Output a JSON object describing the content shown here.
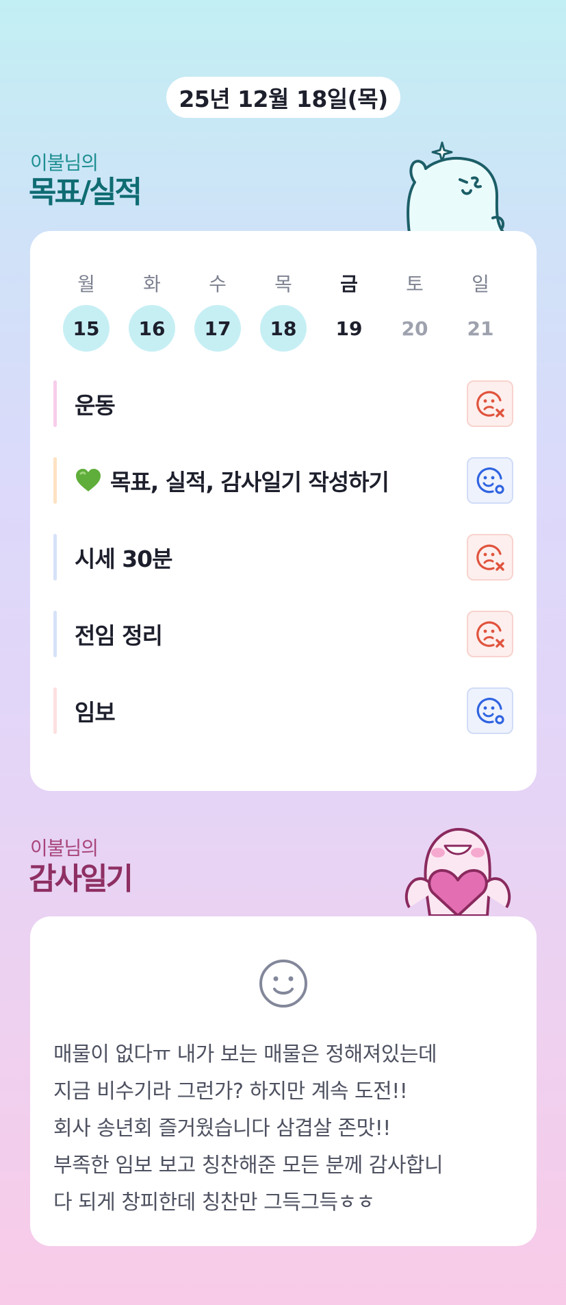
{
  "header": {
    "date": "25년 12월 18일(목)"
  },
  "goals_section": {
    "subtitle": "이불님의",
    "title": "목표/실적",
    "week": [
      {
        "name": "월",
        "num": "15",
        "state": "done"
      },
      {
        "name": "화",
        "num": "16",
        "state": "done"
      },
      {
        "name": "수",
        "num": "17",
        "state": "done"
      },
      {
        "name": "목",
        "num": "18",
        "state": "done"
      },
      {
        "name": "금",
        "num": "19",
        "state": "today"
      },
      {
        "name": "토",
        "num": "20",
        "state": "future"
      },
      {
        "name": "일",
        "num": "21",
        "state": "future"
      }
    ],
    "goals": [
      {
        "label": "운동",
        "status": "fail",
        "status_icon": "sad-face-x-icon",
        "bar_color": "#f7cdea"
      },
      {
        "label": "목표, 실적, 감사일기 작성하기",
        "emoji": "green-heart-icon",
        "status": "ok",
        "status_icon": "smile-face-o-icon",
        "bar_color": "#fde2c3"
      },
      {
        "label": "시세 30분",
        "status": "fail",
        "status_icon": "sad-face-x-icon",
        "bar_color": "#d7e2f8"
      },
      {
        "label": "전임 정리",
        "status": "fail",
        "status_icon": "sad-face-x-icon",
        "bar_color": "#d7e2f8"
      },
      {
        "label": "임보",
        "status": "ok",
        "status_icon": "smile-face-o-icon",
        "bar_color": "#fde0e0"
      }
    ]
  },
  "gratitude_section": {
    "subtitle": "이불님의",
    "title": "감사일기",
    "mood_icon": "smile-face-icon",
    "lines": [
      "매물이 없다ㅠ 내가 보는 매물은 정해져있는데",
      "지금 비수기라 그런가? 하지만 계속 도전!!",
      "회사 송년회 즐거웠습니다 삼겹살 존맛!!",
      "부족한 임보 보고 칭찬해준 모든 분께 감사합니",
      "다 되게 창피한데 칭찬만 그득그득ㅎㅎ"
    ]
  },
  "colors": {
    "fail": "#e0533d",
    "ok": "#2f63e0",
    "done_day": "#c6eff4",
    "goal_title": "#0f6c72",
    "gratitude_title": "#8e2f63"
  }
}
